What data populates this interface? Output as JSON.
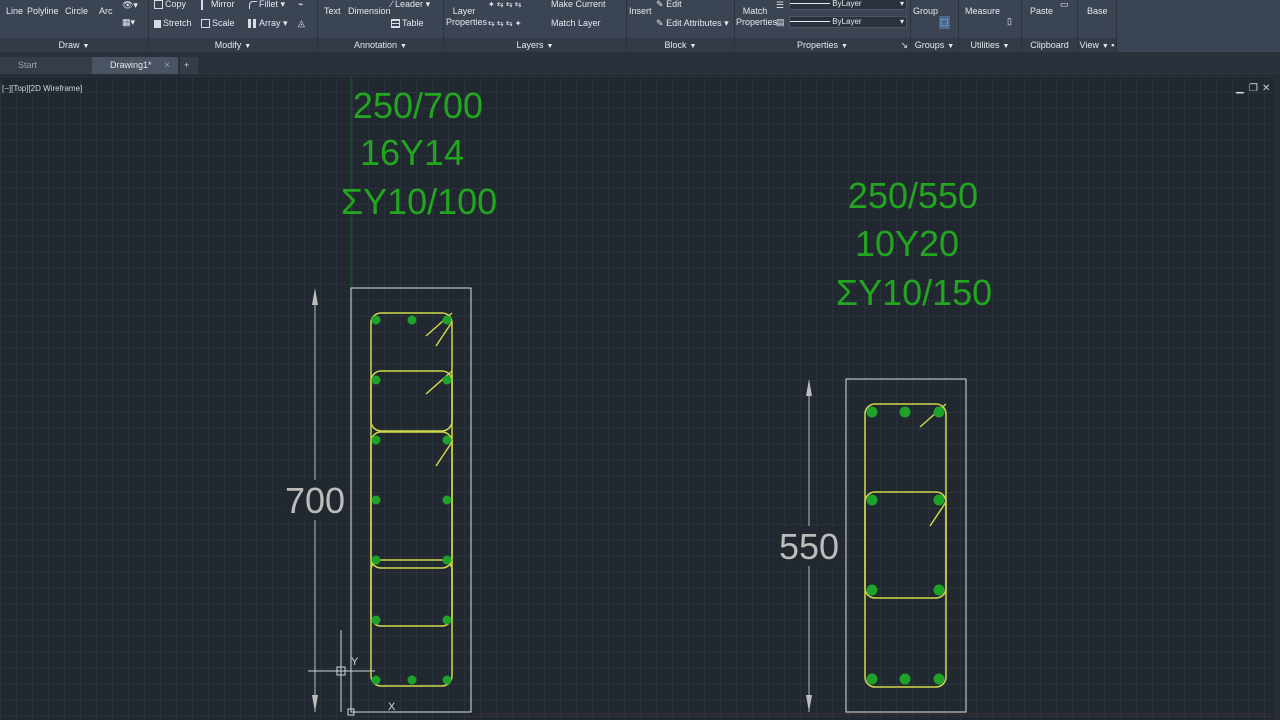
{
  "ribbon": {
    "draw": {
      "title": "Draw",
      "line": "Line",
      "polyline": "Polyline",
      "circle": "Circle",
      "arc": "Arc"
    },
    "modify": {
      "title": "Modify",
      "copy": "Copy",
      "mirror": "Mirror",
      "fillet": "Fillet",
      "stretch": "Stretch",
      "scale": "Scale",
      "array": "Array"
    },
    "annotation": {
      "title": "Annotation",
      "text": "Text",
      "dimension": "Dimension",
      "leader": "Leader",
      "table": "Table"
    },
    "layers": {
      "title": "Layers",
      "layer_properties_1": "Layer",
      "layer_properties_2": "Properties",
      "make_current": "Make Current",
      "match_layer": "Match Layer"
    },
    "block": {
      "title": "Block",
      "insert": "Insert",
      "edit": "Edit",
      "edit_attributes": "Edit Attributes"
    },
    "properties": {
      "title": "Properties",
      "match_1": "Match",
      "match_2": "Properties",
      "color": "ByLayer",
      "linetype": "ByLayer"
    },
    "groups": {
      "title": "Groups",
      "group": "Group"
    },
    "utilities": {
      "title": "Utilities",
      "measure": "Measure"
    },
    "clipboard": {
      "title": "Clipboard",
      "paste": "Paste"
    },
    "view": {
      "title": "View",
      "base": "Base"
    }
  },
  "tabs": {
    "start": "Start",
    "drawing": "Drawing1*",
    "close": "×",
    "add": "+"
  },
  "viewport": {
    "label": "[−][Top][2D Wireframe]",
    "minimize": "▁",
    "restore": "❐",
    "close": "✕"
  },
  "drawing": {
    "beam1": {
      "line1": "250/700",
      "line2": "16Y14",
      "line3": "ΣY10/100",
      "dimension": "700"
    },
    "beam2": {
      "line1": "250/550",
      "line2": "10Y20",
      "line3": "ΣY10/150",
      "dimension": "550"
    },
    "ucs": {
      "x": "X",
      "y": "Y"
    }
  },
  "colors": {
    "annotation": "#22a51f",
    "stirrup": "#cfd84a",
    "rebar": "#1fa22a",
    "section": "#e0e0e0",
    "dimension": "#bcbcbc"
  }
}
